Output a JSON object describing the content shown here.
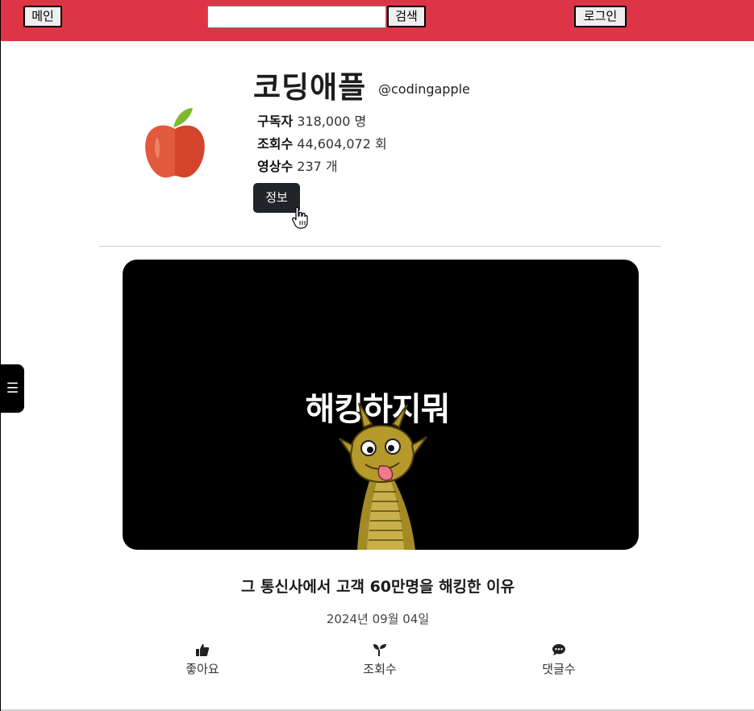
{
  "header": {
    "main_label": "메인",
    "search_placeholder": "",
    "search_value": "",
    "search_label": "검색",
    "login_label": "로그인",
    "bar_color": "#dd3546"
  },
  "channel": {
    "name": "코딩애플",
    "handle": "@codingapple",
    "logo_icon": "apple-icon",
    "stats": [
      {
        "label": "구독자",
        "value": "318,000",
        "unit": "명"
      },
      {
        "label": "조회수",
        "value": "44,604,072",
        "unit": "회"
      },
      {
        "label": "영상수",
        "value": "237",
        "unit": "개"
      }
    ],
    "info_label": "정보"
  },
  "video": {
    "thumbnail_text": "해킹하지뭐",
    "title": "그 통신사에서 고객 60만명을 해킹한 이유",
    "date": "2024년 09월 04일",
    "metrics": [
      {
        "icon": "thumbs-up-icon",
        "label": "좋아요"
      },
      {
        "icon": "sprout-icon",
        "label": "조회수"
      },
      {
        "icon": "comment-icon",
        "label": "댓글수"
      }
    ]
  },
  "sidebar_toggle": {
    "icon": "hamburger-icon",
    "glyph": "☰"
  }
}
